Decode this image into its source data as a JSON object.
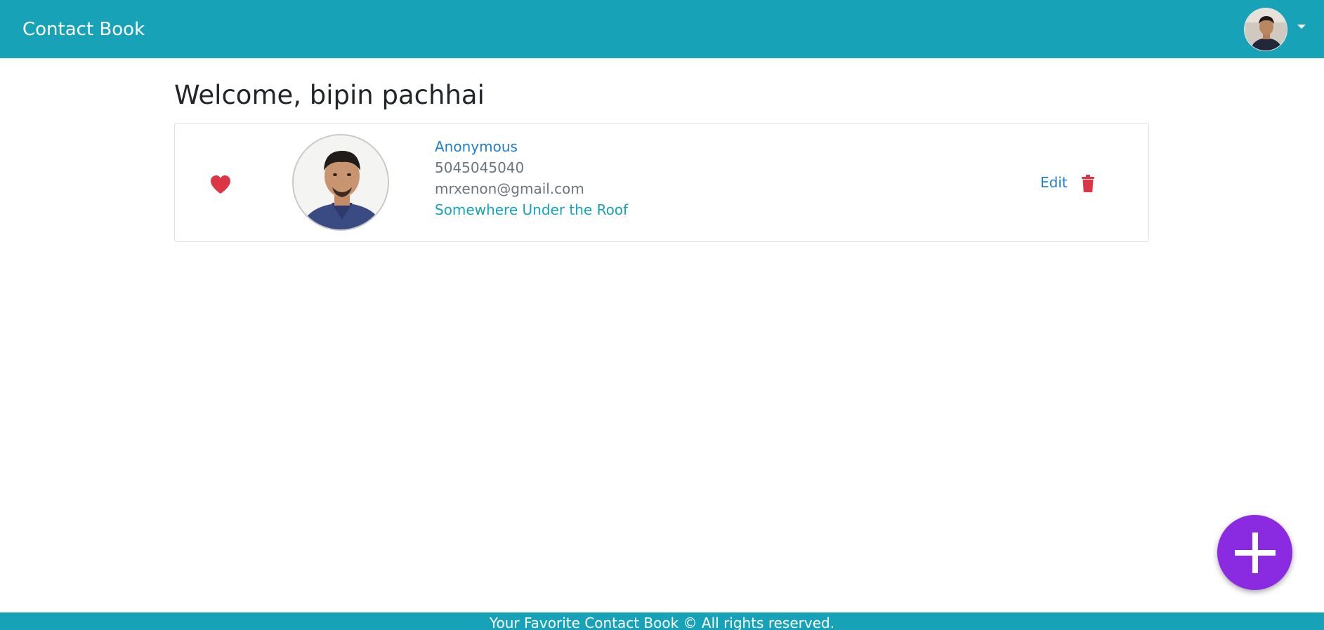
{
  "navbar": {
    "brand": "Contact Book",
    "user_avatar_icon": "user-avatar-photo",
    "dropdown_icon": "caret-down-icon"
  },
  "welcome": {
    "text": "Welcome, bipin pachhai"
  },
  "contacts": [
    {
      "favorite_icon": "heart-icon",
      "photo_icon": "contact-photo",
      "name": "Anonymous",
      "phone": "5045045040",
      "email": "mrxenon@gmail.com",
      "address": "Somewhere Under the Roof",
      "edit_label": "Edit",
      "delete_icon": "trash-icon"
    }
  ],
  "fab": {
    "icon": "plus-icon"
  },
  "footer": {
    "text": "Your Favorite Contact Book © All rights reserved."
  },
  "colors": {
    "navbar": "#17a2b8",
    "favorite": "#dc3545",
    "delete": "#dc3545",
    "link": "#1f7ed0",
    "fab": "#8a2be2"
  }
}
